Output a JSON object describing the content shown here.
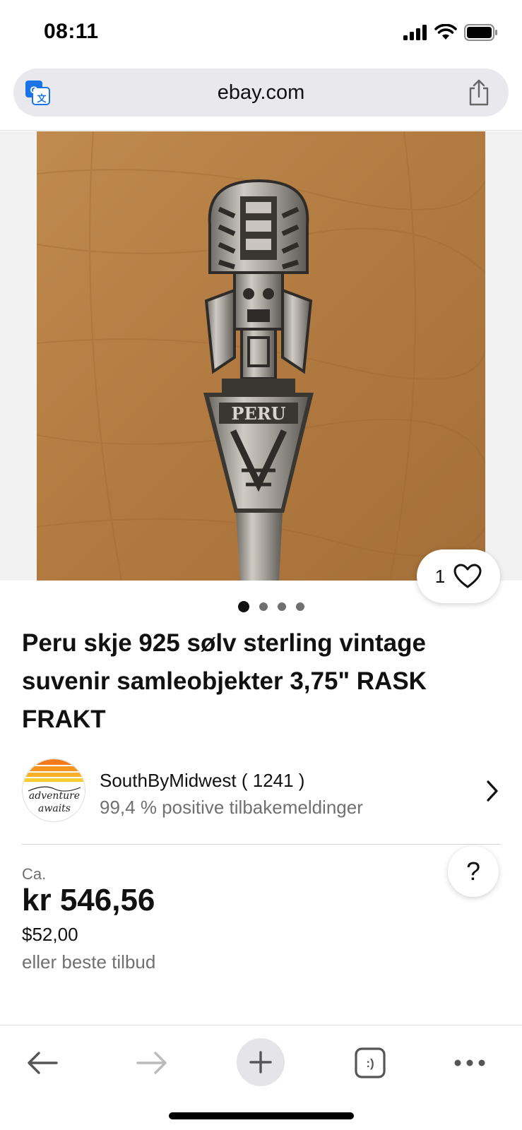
{
  "status_bar": {
    "time": "08:11"
  },
  "browser": {
    "url": "ebay.com",
    "icons": [
      "translate-icon",
      "share-icon"
    ]
  },
  "gallery": {
    "image_count": 4,
    "active_index": 0,
    "watch_count": "1"
  },
  "listing": {
    "title": "Peru skje 925 sølv sterling vintage suvenir samleobjekter 3,75\" RASK FRAKT"
  },
  "seller": {
    "name": "SouthByMidwest ( 1241 )",
    "feedback": "99,4 % positive tilbakemeldinger",
    "avatar_text_line1": "adventure",
    "avatar_text_line2": "awaits"
  },
  "price": {
    "approx_label": "Ca.",
    "converted": "kr 546,56",
    "original": "$52,00",
    "offer_text": "eller beste tilbud"
  },
  "help": {
    "label": "?"
  },
  "toolbar": {
    "tabs_label": ":)"
  },
  "colors": {
    "text_primary": "#111111",
    "text_secondary": "#707070",
    "url_bar_bg": "#e8e8ed",
    "translate_blue": "#1a73e8",
    "photo_wood": "#b7834a"
  }
}
